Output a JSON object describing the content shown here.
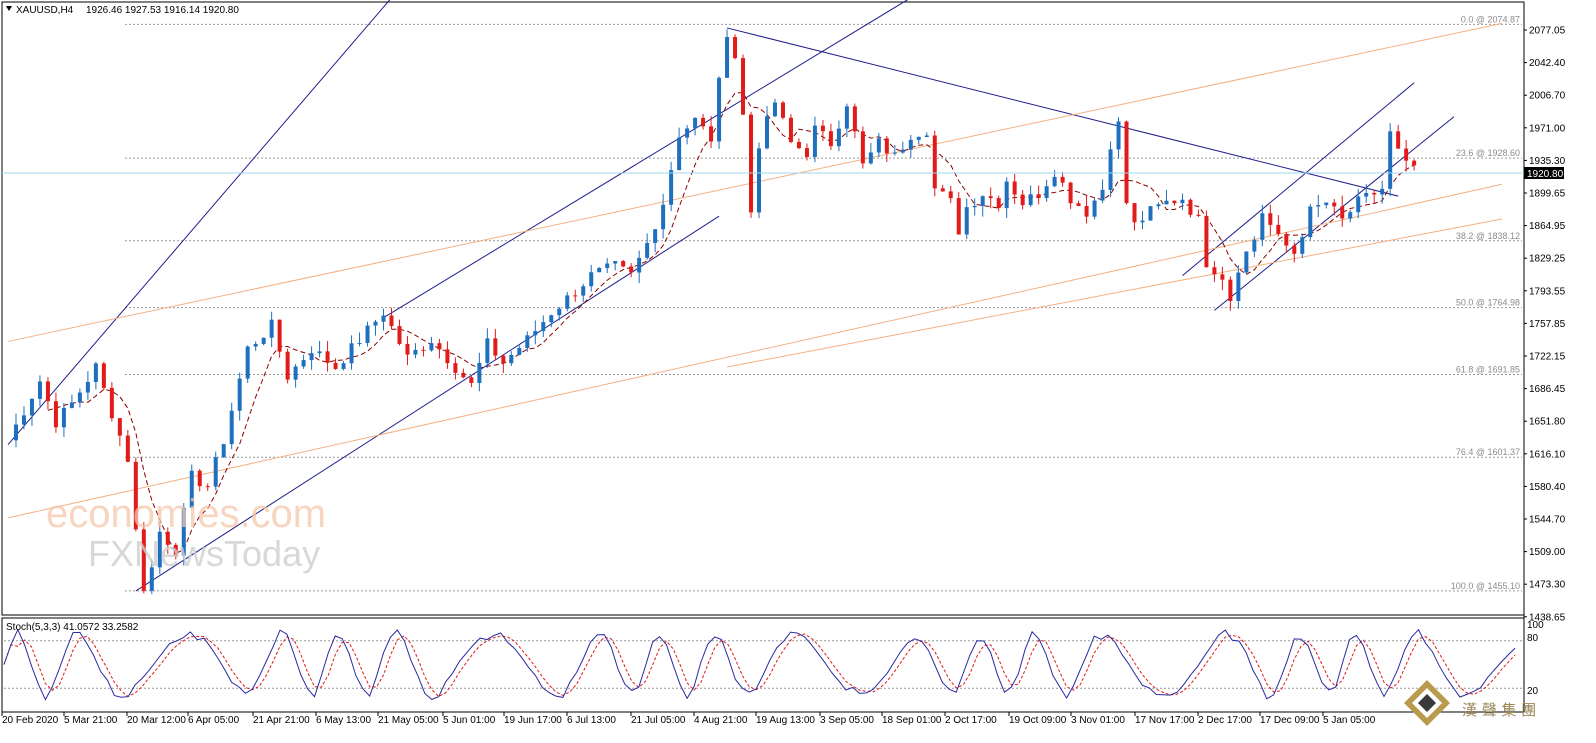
{
  "header": {
    "symbol": "XAUUSD,H4",
    "ohlc": "1926.46 1927.53 1916.14 1920.80"
  },
  "stoch_label": "Stoch(5,3,3) 41.0572 33.2582",
  "stoch_axis": [
    "100",
    "80",
    "20"
  ],
  "current_price": "1920.80",
  "watermark": {
    "line1": "economies.com",
    "line2": "FXNewsToday"
  },
  "brand": {
    "text": "漢 聲 集 團"
  },
  "colors": {
    "channel": "#1e1e8c",
    "fib_fan": "#f4b183",
    "candle_up": "#1f6fbf",
    "candle_down": "#e11a1a",
    "ma": "#8b0000",
    "grid": "#9a9a9a",
    "price_tag": "#000000"
  },
  "chart_data": {
    "type": "candlestick",
    "symbol": "XAUUSD",
    "timeframe": "H4",
    "y_ticks": [
      "2077.05",
      "2042.40",
      "2006.70",
      "1971.00",
      "1935.30",
      "1899.65",
      "1864.95",
      "1829.25",
      "1793.55",
      "1757.85",
      "1722.15",
      "1686.45",
      "1651.80",
      "1616.10",
      "1580.40",
      "1544.70",
      "1509.00",
      "1473.30",
      "1438.65"
    ],
    "x_ticks": [
      "20 Feb 2020",
      "5 Mar 21:00",
      "20 Mar 12:00",
      "6 Apr 05:00",
      "21 Apr 21:00",
      "6 May 13:00",
      "21 May 05:00",
      "5 Jun 01:00",
      "19 Jun 17:00",
      "6 Jul 13:00",
      "21 Jul 05:00",
      "4 Aug 21:00",
      "19 Aug 13:00",
      "3 Sep 05:00",
      "18 Sep 01:00",
      "2 Oct 17:00",
      "19 Oct 09:00",
      "3 Nov 01:00",
      "17 Nov 17:00",
      "2 Dec 17:00",
      "17 Dec 09:00",
      "5 Jan 05:00"
    ],
    "fib_levels": [
      {
        "label": "0.0 @ 2074.87",
        "value": 2074.87
      },
      {
        "label": "23.6 @ 1928.60",
        "value": 1928.6
      },
      {
        "label": "38.2 @ 1838.12",
        "value": 1838.12
      },
      {
        "label": "50.0 @ 1764.98",
        "value": 1764.98
      },
      {
        "label": "61.8 @ 1691.85",
        "value": 1691.85
      },
      {
        "label": "76.4 @ 1601.37",
        "value": 1601.37
      },
      {
        "label": "100.0 @ 1455.10",
        "value": 1455.1
      }
    ],
    "ylim": [
      1432.0,
      2095.0
    ],
    "trend": [
      [
        0,
        1620
      ],
      [
        4,
        1685
      ],
      [
        6,
        1640
      ],
      [
        8,
        1660
      ],
      [
        11,
        1700
      ],
      [
        13,
        1650
      ],
      [
        15,
        1600
      ],
      [
        16,
        1520
      ],
      [
        17,
        1460
      ],
      [
        18,
        1480
      ],
      [
        19,
        1520
      ],
      [
        21,
        1500
      ],
      [
        23,
        1580
      ],
      [
        25,
        1570
      ],
      [
        27,
        1620
      ],
      [
        30,
        1720
      ],
      [
        33,
        1745
      ],
      [
        35,
        1690
      ],
      [
        38,
        1720
      ],
      [
        41,
        1700
      ],
      [
        45,
        1740
      ],
      [
        47,
        1760
      ],
      [
        50,
        1710
      ],
      [
        53,
        1730
      ],
      [
        56,
        1700
      ],
      [
        58,
        1680
      ],
      [
        60,
        1725
      ],
      [
        62,
        1705
      ],
      [
        65,
        1730
      ],
      [
        68,
        1760
      ],
      [
        70,
        1775
      ],
      [
        73,
        1800
      ],
      [
        76,
        1810
      ],
      [
        78,
        1800
      ],
      [
        80,
        1835
      ],
      [
        82,
        1880
      ],
      [
        84,
        1955
      ],
      [
        86,
        1970
      ],
      [
        88,
        1950
      ],
      [
        89,
        2010
      ],
      [
        90,
        2068
      ],
      [
        91,
        2040
      ],
      [
        92,
        1975
      ],
      [
        93,
        1870
      ],
      [
        94,
        1945
      ],
      [
        96,
        1990
      ],
      [
        98,
        1945
      ],
      [
        100,
        1935
      ],
      [
        101,
        1960
      ],
      [
        103,
        1945
      ],
      [
        105,
        1990
      ],
      [
        107,
        1920
      ],
      [
        109,
        1945
      ],
      [
        111,
        1930
      ],
      [
        113,
        1955
      ],
      [
        115,
        1960
      ],
      [
        116,
        1895
      ],
      [
        118,
        1880
      ],
      [
        119,
        1850
      ],
      [
        120,
        1875
      ],
      [
        122,
        1890
      ],
      [
        124,
        1880
      ],
      [
        125,
        1905
      ],
      [
        127,
        1880
      ],
      [
        129,
        1890
      ],
      [
        131,
        1915
      ],
      [
        133,
        1885
      ],
      [
        135,
        1870
      ],
      [
        137,
        1895
      ],
      [
        138,
        1945
      ],
      [
        139,
        1965
      ],
      [
        140,
        1880
      ],
      [
        141,
        1855
      ],
      [
        143,
        1870
      ],
      [
        145,
        1880
      ],
      [
        147,
        1885
      ],
      [
        149,
        1860
      ],
      [
        150,
        1815
      ],
      [
        152,
        1800
      ],
      [
        153,
        1775
      ],
      [
        154,
        1810
      ],
      [
        156,
        1840
      ],
      [
        157,
        1870
      ],
      [
        159,
        1840
      ],
      [
        161,
        1825
      ],
      [
        163,
        1870
      ],
      [
        165,
        1880
      ],
      [
        167,
        1860
      ],
      [
        169,
        1880
      ],
      [
        171,
        1890
      ],
      [
        172,
        1895
      ],
      [
        173,
        1955
      ],
      [
        174,
        1935
      ],
      [
        175,
        1920
      ]
    ],
    "lines": [
      {
        "name": "channel-upper",
        "color": "#1e1e8c",
        "p1": [
          0,
          1615
        ],
        "p2": [
          48,
          2104
        ]
      },
      {
        "name": "channel-middle",
        "color": "#1e1e8c",
        "p1": [
          47,
          1754
        ],
        "p2": [
          113,
          2104
        ]
      },
      {
        "name": "channel-lower",
        "color": "#1e1e8c",
        "p1": [
          16,
          1455
        ],
        "p2": [
          89,
          1865
        ]
      },
      {
        "name": "downtrend",
        "color": "#1e1e8c",
        "p1": [
          90,
          2071
        ],
        "p2": [
          174,
          1887
        ]
      },
      {
        "name": "small-channel-upper",
        "color": "#1e1e8c",
        "p1": [
          147,
          1800
        ],
        "p2": [
          176,
          2011
        ]
      },
      {
        "name": "small-channel-lower",
        "color": "#1e1e8c",
        "p1": [
          151,
          1762
        ],
        "p2": [
          181,
          1974
        ]
      },
      {
        "name": "fan-upper",
        "color": "#f4b183",
        "p1": [
          0,
          1728
        ],
        "p2": [
          187,
          2076
        ]
      },
      {
        "name": "fan-middle",
        "color": "#f4b183",
        "p1": [
          0,
          1535
        ],
        "p2": [
          187,
          1900
        ]
      },
      {
        "name": "fan-lower",
        "color": "#f4b183",
        "p1": [
          90,
          1700
        ],
        "p2": [
          187,
          1862
        ]
      }
    ],
    "stochastic": {
      "levels": [
        80,
        20
      ],
      "k_last": 41.0572,
      "d_last": 33.2582
    }
  }
}
